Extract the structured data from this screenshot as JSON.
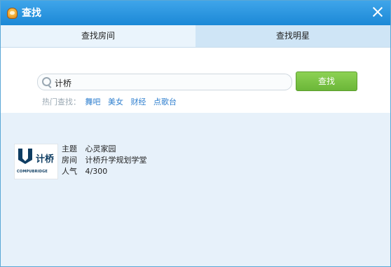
{
  "window": {
    "title": "查找",
    "accent": "#2294de",
    "button_green": "#76bf3f"
  },
  "tabs": [
    {
      "label": "查找房间",
      "active": true
    },
    {
      "label": "查找明星",
      "active": false
    }
  ],
  "search": {
    "value": "计桥",
    "button_label": "查找"
  },
  "hot": {
    "label": "热门查找：",
    "links": [
      "舞吧",
      "美女",
      "财经",
      "点歌台"
    ]
  },
  "result": {
    "logo_text": "计桥",
    "logo_sub": "COMPUBRIDGE",
    "rows": [
      {
        "key": "主题",
        "value": "心灵家园"
      },
      {
        "key": "房间",
        "value": "计桥升学规划学堂"
      },
      {
        "key": "人气",
        "value": "4/300"
      }
    ]
  }
}
